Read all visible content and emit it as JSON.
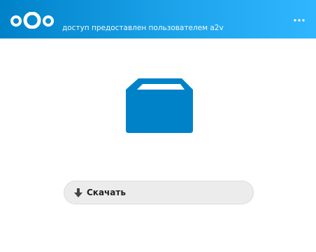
{
  "header": {
    "shared_by_text": "доступ предоставлен пользователем a2v",
    "logo_icon": "nextcloud-logo",
    "menu_icon": "more-horizontal-icon",
    "gradient_start": "#0082c9",
    "gradient_end": "#30b6ff"
  },
  "main": {
    "share_type_icon": "folder-icon",
    "folder_color": "#0082c9"
  },
  "download": {
    "label": "Скачать",
    "icon": "download-icon"
  }
}
